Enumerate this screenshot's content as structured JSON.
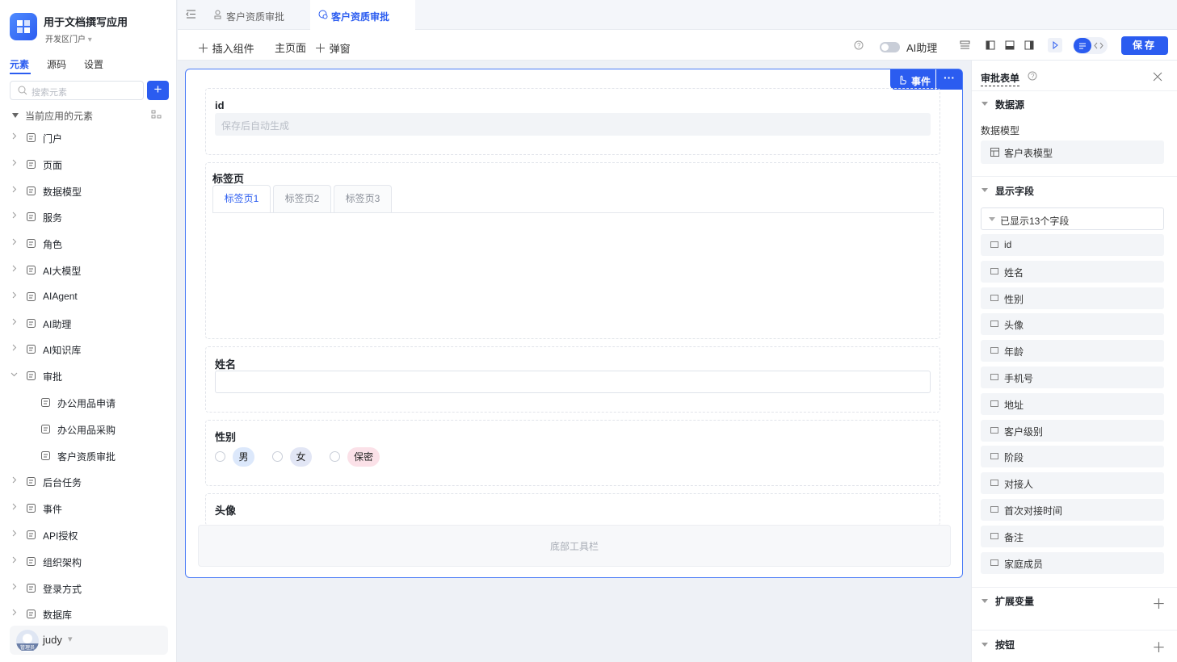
{
  "app": {
    "title": "用于文档撰写应用",
    "env": "开发区门户"
  },
  "sidebar": {
    "tabs": [
      "元素",
      "源码",
      "设置"
    ],
    "search_placeholder": "搜索元素",
    "section_title": "当前应用的元素",
    "items": [
      {
        "label": "门户",
        "icon": "home-icon"
      },
      {
        "label": "页面",
        "icon": "page-icon"
      },
      {
        "label": "数据模型",
        "icon": "table-icon"
      },
      {
        "label": "服务",
        "icon": "service-icon"
      },
      {
        "label": "角色",
        "icon": "role-icon"
      },
      {
        "label": "AI大模型",
        "icon": "cube-icon"
      },
      {
        "label": "AIAgent",
        "icon": "robot-icon"
      },
      {
        "label": "AI助理",
        "icon": "ai-icon"
      },
      {
        "label": "AI知识库",
        "icon": "book-icon"
      },
      {
        "label": "审批",
        "icon": "stamp-icon"
      },
      {
        "label": "办公用品申请",
        "icon": "stamp-icon"
      },
      {
        "label": "办公用品采购",
        "icon": "stamp-icon"
      },
      {
        "label": "客户资质审批",
        "icon": "stamp-icon"
      },
      {
        "label": "后台任务",
        "icon": "task-icon"
      },
      {
        "label": "事件",
        "icon": "event-icon"
      },
      {
        "label": "API授权",
        "icon": "key-icon"
      },
      {
        "label": "组织架构",
        "icon": "org-icon"
      },
      {
        "label": "登录方式",
        "icon": "login-icon"
      },
      {
        "label": "数据库",
        "icon": "database-icon"
      }
    ],
    "user": {
      "name": "judy",
      "badge": "管理员"
    }
  },
  "tabbar": {
    "tabs": [
      "客户资质审批",
      "客户资质审批"
    ]
  },
  "toolbar": {
    "insert": "插入组件",
    "main_page": "主页面",
    "popup": "弹窗",
    "ai_assistant": "AI助理",
    "save": "保存"
  },
  "form": {
    "event_btn": "事件",
    "more_btn": "···",
    "id_label": "id",
    "id_placeholder": "保存后自动生成",
    "tabs_label": "标签页",
    "tabs": [
      "标签页1",
      "标签页2",
      "标签页3"
    ],
    "name_label": "姓名",
    "gender_label": "性别",
    "gender_options": [
      "男",
      "女",
      "保密"
    ],
    "avatar_label": "头像",
    "bottom_bar": "底部工具栏"
  },
  "panel": {
    "title": "审批表单",
    "datasource": "数据源",
    "model_label": "数据模型",
    "model_value": "客户表模型",
    "fields_title": "显示字段",
    "fields_shown": "已显示13个字段",
    "fields": [
      "id",
      "姓名",
      "性别",
      "头像",
      "年龄",
      "手机号",
      "地址",
      "客户级别",
      "阶段",
      "对接人",
      "首次对接时间",
      "备注",
      "家庭成员"
    ],
    "ext_vars": "扩展变量",
    "buttons": "按钮"
  },
  "colors": {
    "accent": "#2b5cf0",
    "border_active": "#4a7bf7"
  }
}
